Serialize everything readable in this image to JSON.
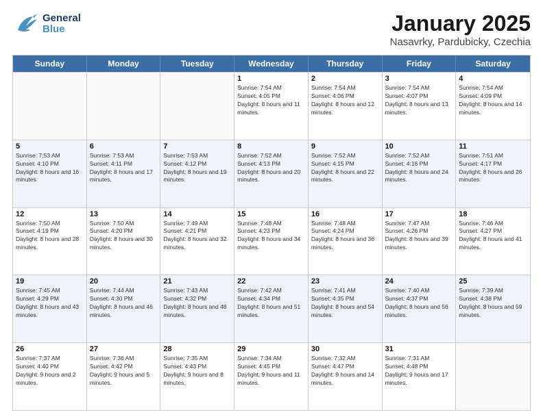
{
  "header": {
    "logo_general": "General",
    "logo_blue": "Blue",
    "title": "January 2025",
    "subtitle": "Nasavrky, Pardubicky, Czechia"
  },
  "days_of_week": [
    "Sunday",
    "Monday",
    "Tuesday",
    "Wednesday",
    "Thursday",
    "Friday",
    "Saturday"
  ],
  "weeks": [
    [
      {
        "day": "",
        "sunrise": "",
        "sunset": "",
        "daylight": "",
        "empty": true
      },
      {
        "day": "",
        "sunrise": "",
        "sunset": "",
        "daylight": "",
        "empty": true
      },
      {
        "day": "",
        "sunrise": "",
        "sunset": "",
        "daylight": "",
        "empty": true
      },
      {
        "day": "1",
        "sunrise": "Sunrise: 7:54 AM",
        "sunset": "Sunset: 4:05 PM",
        "daylight": "Daylight: 8 hours and 11 minutes.",
        "empty": false
      },
      {
        "day": "2",
        "sunrise": "Sunrise: 7:54 AM",
        "sunset": "Sunset: 4:06 PM",
        "daylight": "Daylight: 8 hours and 12 minutes.",
        "empty": false
      },
      {
        "day": "3",
        "sunrise": "Sunrise: 7:54 AM",
        "sunset": "Sunset: 4:07 PM",
        "daylight": "Daylight: 8 hours and 13 minutes.",
        "empty": false
      },
      {
        "day": "4",
        "sunrise": "Sunrise: 7:54 AM",
        "sunset": "Sunset: 4:09 PM",
        "daylight": "Daylight: 8 hours and 14 minutes.",
        "empty": false
      }
    ],
    [
      {
        "day": "5",
        "sunrise": "Sunrise: 7:53 AM",
        "sunset": "Sunset: 4:10 PM",
        "daylight": "Daylight: 8 hours and 16 minutes.",
        "empty": false
      },
      {
        "day": "6",
        "sunrise": "Sunrise: 7:53 AM",
        "sunset": "Sunset: 4:11 PM",
        "daylight": "Daylight: 8 hours and 17 minutes.",
        "empty": false
      },
      {
        "day": "7",
        "sunrise": "Sunrise: 7:53 AM",
        "sunset": "Sunset: 4:12 PM",
        "daylight": "Daylight: 8 hours and 19 minutes.",
        "empty": false
      },
      {
        "day": "8",
        "sunrise": "Sunrise: 7:52 AM",
        "sunset": "Sunset: 4:13 PM",
        "daylight": "Daylight: 8 hours and 20 minutes.",
        "empty": false
      },
      {
        "day": "9",
        "sunrise": "Sunrise: 7:52 AM",
        "sunset": "Sunset: 4:15 PM",
        "daylight": "Daylight: 8 hours and 22 minutes.",
        "empty": false
      },
      {
        "day": "10",
        "sunrise": "Sunrise: 7:52 AM",
        "sunset": "Sunset: 4:16 PM",
        "daylight": "Daylight: 8 hours and 24 minutes.",
        "empty": false
      },
      {
        "day": "11",
        "sunrise": "Sunrise: 7:51 AM",
        "sunset": "Sunset: 4:17 PM",
        "daylight": "Daylight: 8 hours and 26 minutes.",
        "empty": false
      }
    ],
    [
      {
        "day": "12",
        "sunrise": "Sunrise: 7:50 AM",
        "sunset": "Sunset: 4:19 PM",
        "daylight": "Daylight: 8 hours and 28 minutes.",
        "empty": false
      },
      {
        "day": "13",
        "sunrise": "Sunrise: 7:50 AM",
        "sunset": "Sunset: 4:20 PM",
        "daylight": "Daylight: 8 hours and 30 minutes.",
        "empty": false
      },
      {
        "day": "14",
        "sunrise": "Sunrise: 7:49 AM",
        "sunset": "Sunset: 4:21 PM",
        "daylight": "Daylight: 8 hours and 32 minutes.",
        "empty": false
      },
      {
        "day": "15",
        "sunrise": "Sunrise: 7:48 AM",
        "sunset": "Sunset: 4:23 PM",
        "daylight": "Daylight: 8 hours and 34 minutes.",
        "empty": false
      },
      {
        "day": "16",
        "sunrise": "Sunrise: 7:48 AM",
        "sunset": "Sunset: 4:24 PM",
        "daylight": "Daylight: 8 hours and 36 minutes.",
        "empty": false
      },
      {
        "day": "17",
        "sunrise": "Sunrise: 7:47 AM",
        "sunset": "Sunset: 4:26 PM",
        "daylight": "Daylight: 8 hours and 39 minutes.",
        "empty": false
      },
      {
        "day": "18",
        "sunrise": "Sunrise: 7:46 AM",
        "sunset": "Sunset: 4:27 PM",
        "daylight": "Daylight: 8 hours and 41 minutes.",
        "empty": false
      }
    ],
    [
      {
        "day": "19",
        "sunrise": "Sunrise: 7:45 AM",
        "sunset": "Sunset: 4:29 PM",
        "daylight": "Daylight: 8 hours and 43 minutes.",
        "empty": false
      },
      {
        "day": "20",
        "sunrise": "Sunrise: 7:44 AM",
        "sunset": "Sunset: 4:30 PM",
        "daylight": "Daylight: 8 hours and 46 minutes.",
        "empty": false
      },
      {
        "day": "21",
        "sunrise": "Sunrise: 7:43 AM",
        "sunset": "Sunset: 4:32 PM",
        "daylight": "Daylight: 8 hours and 48 minutes.",
        "empty": false
      },
      {
        "day": "22",
        "sunrise": "Sunrise: 7:42 AM",
        "sunset": "Sunset: 4:34 PM",
        "daylight": "Daylight: 8 hours and 51 minutes.",
        "empty": false
      },
      {
        "day": "23",
        "sunrise": "Sunrise: 7:41 AM",
        "sunset": "Sunset: 4:35 PM",
        "daylight": "Daylight: 8 hours and 54 minutes.",
        "empty": false
      },
      {
        "day": "24",
        "sunrise": "Sunrise: 7:40 AM",
        "sunset": "Sunset: 4:37 PM",
        "daylight": "Daylight: 8 hours and 56 minutes.",
        "empty": false
      },
      {
        "day": "25",
        "sunrise": "Sunrise: 7:39 AM",
        "sunset": "Sunset: 4:38 PM",
        "daylight": "Daylight: 8 hours and 59 minutes.",
        "empty": false
      }
    ],
    [
      {
        "day": "26",
        "sunrise": "Sunrise: 7:37 AM",
        "sunset": "Sunset: 4:40 PM",
        "daylight": "Daylight: 9 hours and 2 minutes.",
        "empty": false
      },
      {
        "day": "27",
        "sunrise": "Sunrise: 7:36 AM",
        "sunset": "Sunset: 4:42 PM",
        "daylight": "Daylight: 9 hours and 5 minutes.",
        "empty": false
      },
      {
        "day": "28",
        "sunrise": "Sunrise: 7:35 AM",
        "sunset": "Sunset: 4:43 PM",
        "daylight": "Daylight: 9 hours and 8 minutes.",
        "empty": false
      },
      {
        "day": "29",
        "sunrise": "Sunrise: 7:34 AM",
        "sunset": "Sunset: 4:45 PM",
        "daylight": "Daylight: 9 hours and 11 minutes.",
        "empty": false
      },
      {
        "day": "30",
        "sunrise": "Sunrise: 7:32 AM",
        "sunset": "Sunset: 4:47 PM",
        "daylight": "Daylight: 9 hours and 14 minutes.",
        "empty": false
      },
      {
        "day": "31",
        "sunrise": "Sunrise: 7:31 AM",
        "sunset": "Sunset: 4:48 PM",
        "daylight": "Daylight: 9 hours and 17 minutes.",
        "empty": false
      },
      {
        "day": "",
        "sunrise": "",
        "sunset": "",
        "daylight": "",
        "empty": true
      }
    ]
  ]
}
